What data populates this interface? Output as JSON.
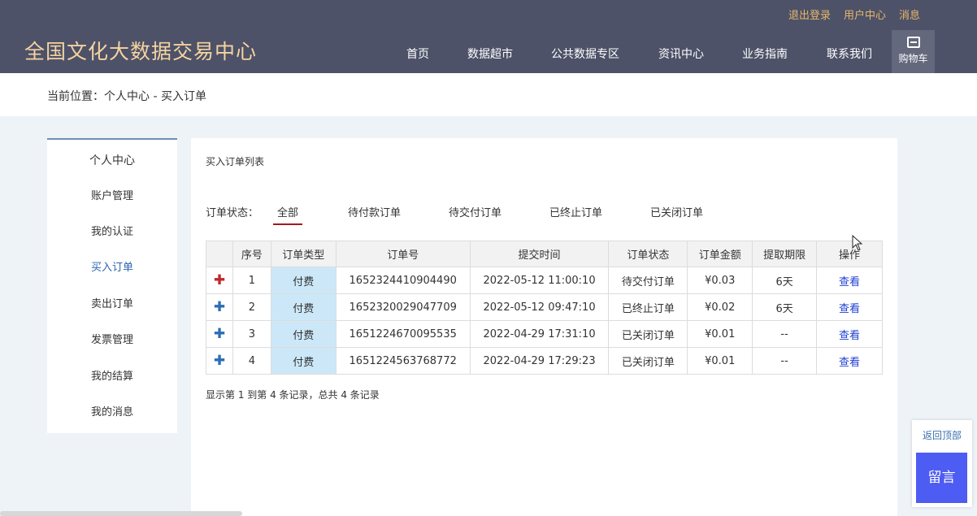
{
  "header": {
    "brand": "全国文化大数据交易中心",
    "top_links": [
      "退出登录",
      "用户中心",
      "消息"
    ],
    "nav": [
      "首页",
      "数据超市",
      "公共数据专区",
      "资讯中心",
      "业务指南",
      "联系我们"
    ],
    "cart_label": "购物车"
  },
  "breadcrumb": "当前位置：个人中心 - 买入订单",
  "sidebar": {
    "title": "个人中心",
    "items": [
      "账户管理",
      "我的认证",
      "买入订单",
      "卖出订单",
      "发票管理",
      "我的结算",
      "我的消息"
    ],
    "active_index": 2
  },
  "panel": {
    "title": "买入订单列表",
    "filter_label": "订单状态：",
    "filter_tabs": [
      "全部",
      "待付款订单",
      "待交付订单",
      "已终止订单",
      "已关闭订单"
    ],
    "active_tab": 0
  },
  "table": {
    "headers": [
      "",
      "序号",
      "订单类型",
      "订单号",
      "提交时间",
      "订单状态",
      "订单金额",
      "提取期限",
      "操作"
    ],
    "rows": [
      {
        "no": "1",
        "type": "付费",
        "order_id": "1652324410904490",
        "time": "2022-05-12 11:00:10",
        "status": "待交付订单",
        "amount": "¥0.03",
        "term": "6天",
        "action": "查看"
      },
      {
        "no": "2",
        "type": "付费",
        "order_id": "1652320029047709",
        "time": "2022-05-12 09:47:10",
        "status": "已终止订单",
        "amount": "¥0.02",
        "term": "6天",
        "action": "查看"
      },
      {
        "no": "3",
        "type": "付费",
        "order_id": "1651224670095535",
        "time": "2022-04-29 17:31:10",
        "status": "已关闭订单",
        "amount": "¥0.01",
        "term": "--",
        "action": "查看"
      },
      {
        "no": "4",
        "type": "付费",
        "order_id": "1651224563768772",
        "time": "2022-04-29 17:29:23",
        "status": "已关闭订单",
        "amount": "¥0.01",
        "term": "--",
        "action": "查看"
      }
    ],
    "expand_symbol": "✚"
  },
  "summary": "显示第 1 到第 4 条记录，总共 4 条记录",
  "float": {
    "back_top": "返回顶部",
    "message": "留言"
  },
  "colors": {
    "header_bg": "#4d5268",
    "brand": "#f5d3a0",
    "top_link": "#e7b76a",
    "active_tab_underline": "#a11b1b",
    "link_blue": "#1f3fd1",
    "message_button": "#4d5cf2",
    "type_cell_bg": "#cce8f8"
  }
}
